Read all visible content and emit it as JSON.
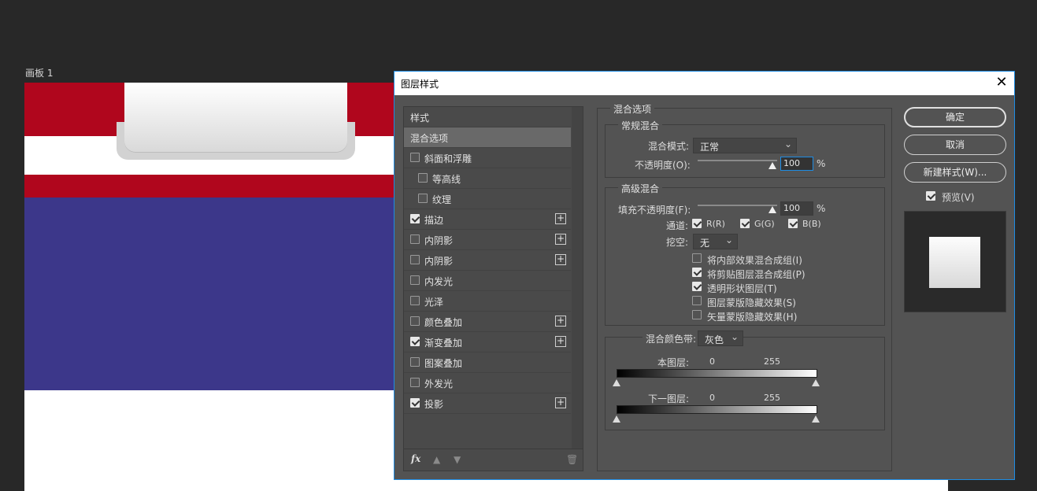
{
  "artboard": {
    "label": "画板 1"
  },
  "colors": {
    "red": "#b0061d",
    "blue": "#3c378a",
    "accent": "#1e8ce3",
    "canvas": "#ffffff"
  },
  "dialog": {
    "title": "图层样式",
    "close_icon": "close-icon",
    "styles_header": "样式",
    "items": [
      {
        "label": "混合选项",
        "checkbox": false,
        "checked": false,
        "plus": false,
        "indent": 0,
        "selected": true
      },
      {
        "label": "斜面和浮雕",
        "checkbox": true,
        "checked": false,
        "plus": false,
        "indent": 0
      },
      {
        "label": "等高线",
        "checkbox": true,
        "checked": false,
        "plus": false,
        "indent": 1
      },
      {
        "label": "纹理",
        "checkbox": true,
        "checked": false,
        "plus": false,
        "indent": 1
      },
      {
        "label": "描边",
        "checkbox": true,
        "checked": true,
        "plus": true,
        "indent": 0
      },
      {
        "label": "内阴影",
        "checkbox": true,
        "checked": false,
        "plus": true,
        "indent": 0
      },
      {
        "label": "内阴影",
        "checkbox": true,
        "checked": false,
        "plus": true,
        "indent": 0
      },
      {
        "label": "内发光",
        "checkbox": true,
        "checked": false,
        "plus": false,
        "indent": 0
      },
      {
        "label": "光泽",
        "checkbox": true,
        "checked": false,
        "plus": false,
        "indent": 0
      },
      {
        "label": "颜色叠加",
        "checkbox": true,
        "checked": false,
        "plus": true,
        "indent": 0
      },
      {
        "label": "渐变叠加",
        "checkbox": true,
        "checked": true,
        "plus": true,
        "indent": 0
      },
      {
        "label": "图案叠加",
        "checkbox": true,
        "checked": false,
        "plus": false,
        "indent": 0
      },
      {
        "label": "外发光",
        "checkbox": true,
        "checked": false,
        "plus": false,
        "indent": 0
      },
      {
        "label": "投影",
        "checkbox": true,
        "checked": true,
        "plus": true,
        "indent": 0
      }
    ],
    "bottom": {
      "fx": "fx",
      "up_icon": "arrow-up-icon",
      "down_icon": "arrow-down-icon",
      "trash_icon": "trash-icon"
    },
    "blend_options": {
      "title": "混合选项",
      "general": {
        "title": "常规混合",
        "mode_label": "混合模式:",
        "mode_value": "正常",
        "opacity_label": "不透明度(O):",
        "opacity_value": "100",
        "opacity_unit": "%"
      },
      "advanced": {
        "title": "高级混合",
        "fill_label": "填充不透明度(F):",
        "fill_value": "100",
        "fill_unit": "%",
        "channels_label": "通道:",
        "channels": [
          {
            "label": "R(R)",
            "checked": true
          },
          {
            "label": "G(G)",
            "checked": true
          },
          {
            "label": "B(B)",
            "checked": true
          }
        ],
        "knockout_label": "挖空:",
        "knockout_value": "无",
        "options": [
          {
            "label": "将内部效果混合成组(I)",
            "checked": false
          },
          {
            "label": "将剪贴图层混合成组(P)",
            "checked": true
          },
          {
            "label": "透明形状图层(T)",
            "checked": true
          },
          {
            "label": "图层蒙版隐藏效果(S)",
            "checked": false
          },
          {
            "label": "矢量蒙版隐藏效果(H)",
            "checked": false
          }
        ]
      },
      "blend_if": {
        "label": "混合颜色带:",
        "value": "灰色",
        "this_layer_label": "本图层:",
        "this_min": "0",
        "this_max": "255",
        "below_label": "下一图层:",
        "below_min": "0",
        "below_max": "255"
      }
    },
    "buttons": {
      "ok": "确定",
      "cancel": "取消",
      "new_style": "新建样式(W)...",
      "preview_label": "预览(V)",
      "preview_checked": true
    }
  }
}
